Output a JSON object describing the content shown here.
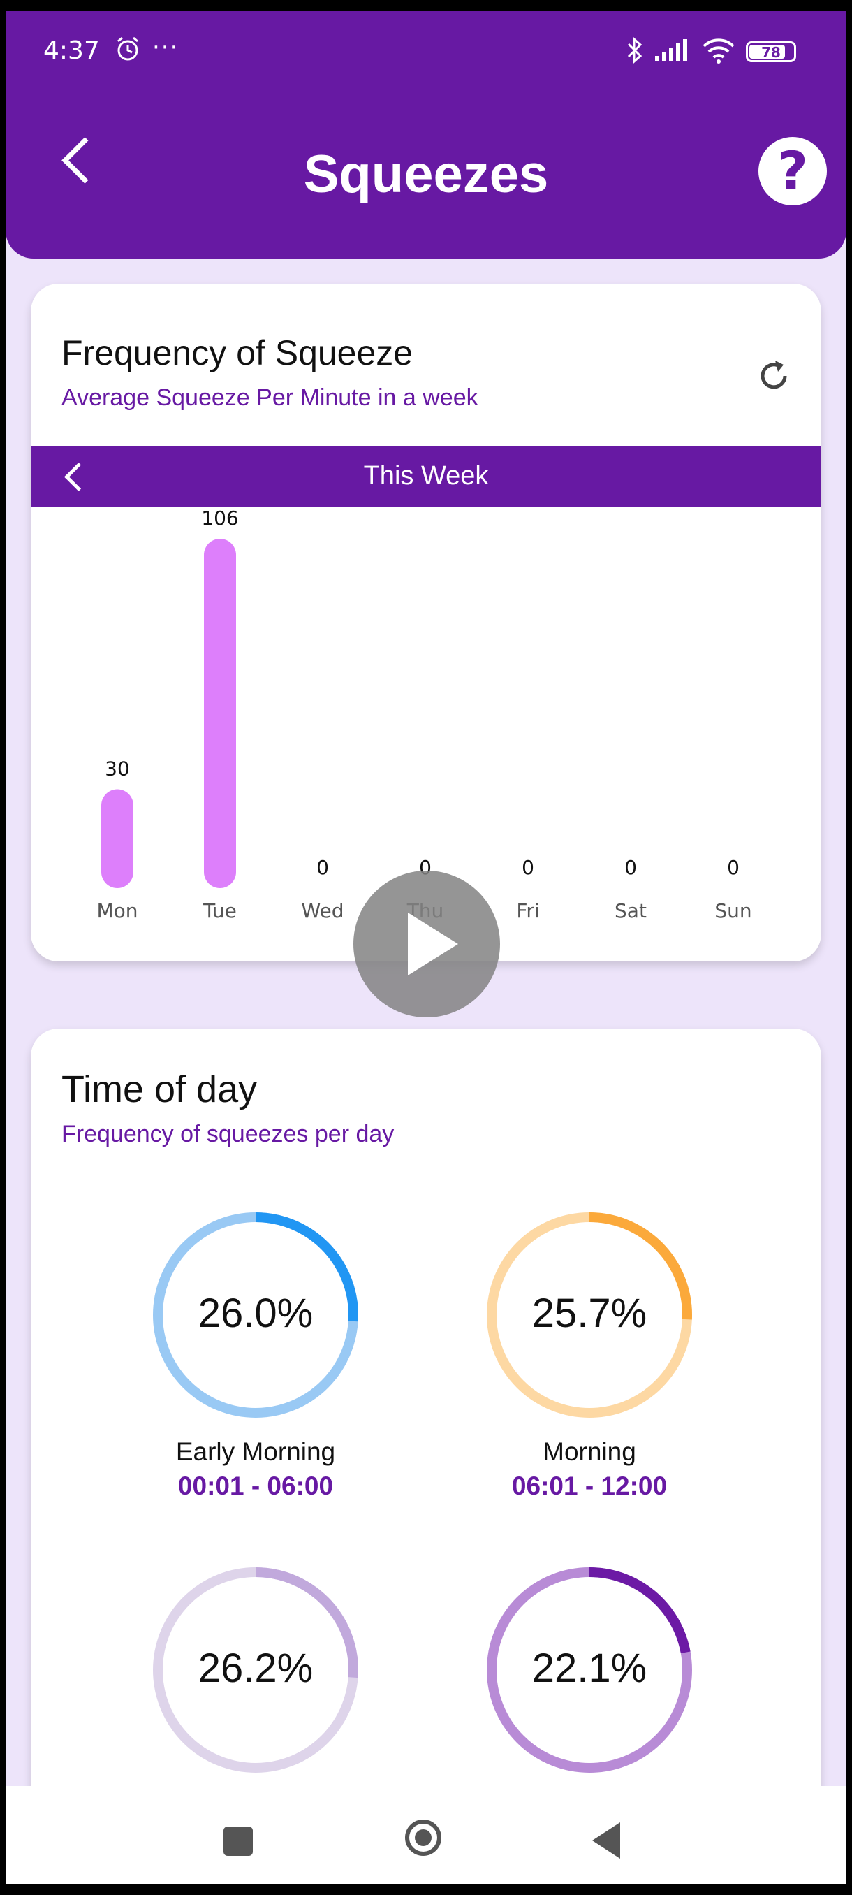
{
  "status": {
    "time": "4:37",
    "more": "···",
    "battery": "78",
    "battery_level": 0.78
  },
  "header": {
    "title": "Squeezes",
    "help": "?"
  },
  "frequency_card": {
    "title": "Frequency of Squeeze",
    "subtitle": "Average Squeeze Per Minute in a week",
    "period": "This Week"
  },
  "chart_data": {
    "type": "bar",
    "categories": [
      "Mon",
      "Tue",
      "Wed",
      "Thu",
      "Fri",
      "Sat",
      "Sun"
    ],
    "values": [
      30,
      106,
      0,
      0,
      0,
      0,
      0
    ],
    "bar_color": "#dd7ffb"
  },
  "time_card": {
    "title": "Time of day",
    "subtitle": "Frequency of squeezes per day",
    "slots": [
      {
        "pct": "26.0%",
        "value": 26.0,
        "label": "Early Morning",
        "range": "00:01 - 06:00",
        "track": "#99c9f4",
        "arc": "#2196f3"
      },
      {
        "pct": "25.7%",
        "value": 25.7,
        "label": "Morning",
        "range": "06:01 - 12:00",
        "track": "#fdd8a3",
        "arc": "#fba93b"
      },
      {
        "pct": "26.2%",
        "value": 26.2,
        "label": "",
        "range": "",
        "track": "#ded4ea",
        "arc": "#c1a9dc"
      },
      {
        "pct": "22.1%",
        "value": 22.1,
        "label": "",
        "range": "",
        "track": "#b88bd6",
        "arc": "#6c1aa5"
      }
    ]
  },
  "colors": {
    "primary": "#6719a3",
    "background": "#ede4fa"
  }
}
